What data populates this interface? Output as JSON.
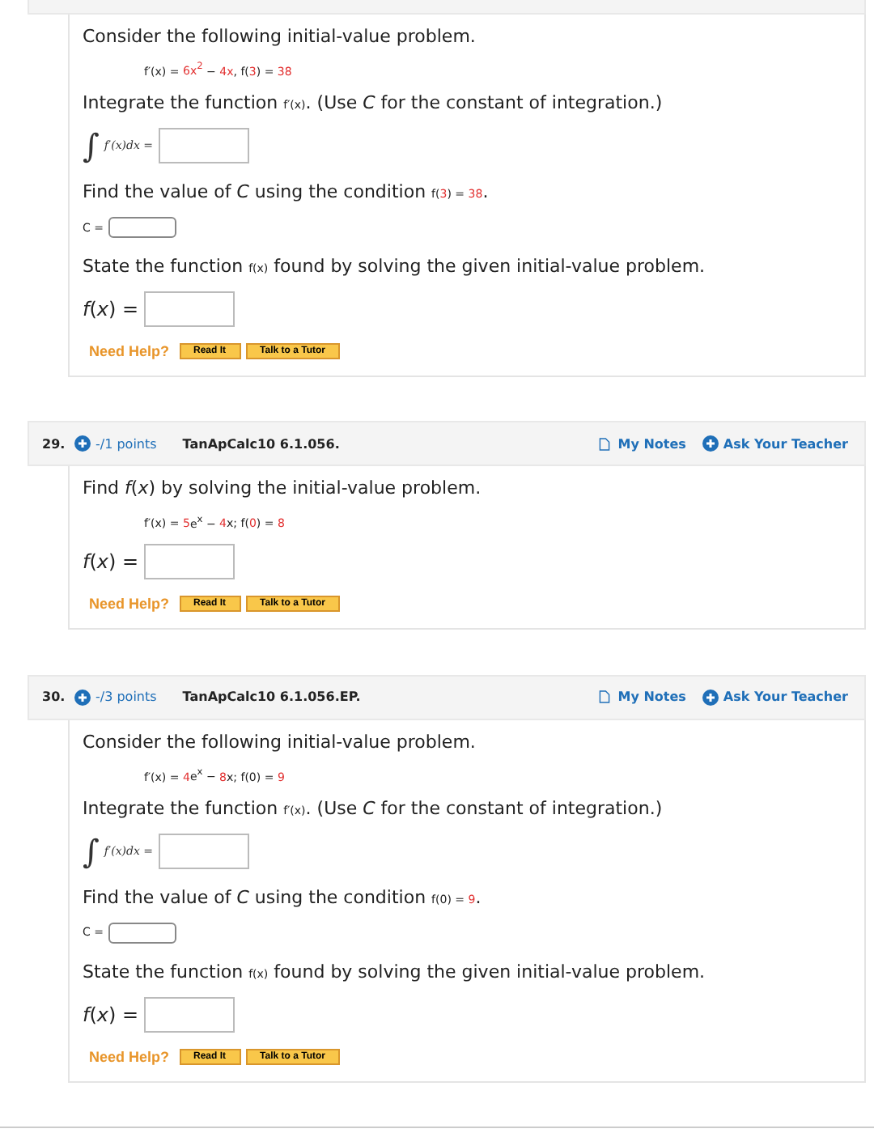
{
  "questions": [
    {
      "parts": [
        {
          "kind": "prose",
          "segments": [
            {
              "kind": "text",
              "text": "Consider the following initial-value problem."
            }
          ]
        },
        {
          "kind": "equation",
          "segments": [
            {
              "kind": "math",
              "text": "f′(x) = "
            },
            {
              "kind": "value",
              "text": "6x$^{2}$"
            },
            {
              "kind": "math",
              "text": " − "
            },
            {
              "kind": "value",
              "text": "4x"
            },
            {
              "kind": "math",
              "text": ", f("
            },
            {
              "kind": "value",
              "text": "3"
            },
            {
              "kind": "math",
              "text": ") = "
            },
            {
              "kind": "value",
              "text": "38"
            }
          ]
        },
        {
          "kind": "prose",
          "segments": [
            {
              "kind": "text",
              "text": "Integrate the function "
            },
            {
              "kind": "math",
              "text": "f′(x)"
            },
            {
              "kind": "text",
              "text": ". (Use *C* for the constant of integration.)"
            }
          ]
        },
        {
          "kind": "integral",
          "sign": "∫",
          "label": "f′(x)dx ="
        },
        {
          "kind": "prose",
          "segments": [
            {
              "kind": "text",
              "text": "Find the value of *C* using the condition "
            },
            {
              "kind": "math",
              "text": "f("
            },
            {
              "kind": "value",
              "text": "3"
            },
            {
              "kind": "math",
              "text": ") = "
            },
            {
              "kind": "value",
              "text": "38"
            },
            {
              "kind": "text",
              "text": "."
            }
          ]
        },
        {
          "kind": "constant",
          "label": "C ="
        },
        {
          "kind": "prose",
          "segments": [
            {
              "kind": "text",
              "text": "State the function "
            },
            {
              "kind": "math",
              "text": "f(x)"
            },
            {
              "kind": "text",
              "text": " found by solving the given initial-value problem."
            }
          ]
        },
        {
          "kind": "function",
          "label": "*f*(*x*) ="
        },
        {
          "kind": "help",
          "label": "Need Help?",
          "buttons": [
            "Read It",
            "Talk to a Tutor"
          ]
        }
      ]
    },
    {
      "header": {
        "number": "29.",
        "points": "-/1 points",
        "code": "TanApCalc10 6.1.056.",
        "notes": "My Notes",
        "ask": "Ask Your Teacher"
      },
      "parts": [
        {
          "kind": "prose",
          "segments": [
            {
              "kind": "text",
              "text": "Find *f*(*x*) by solving the initial-value problem."
            }
          ]
        },
        {
          "kind": "equation",
          "segments": [
            {
              "kind": "math",
              "text": "f′(x) = "
            },
            {
              "kind": "value",
              "text": "5"
            },
            {
              "kind": "math",
              "text": "e$^{x}$ − "
            },
            {
              "kind": "value",
              "text": "4"
            },
            {
              "kind": "math",
              "text": "x; f("
            },
            {
              "kind": "value",
              "text": "0"
            },
            {
              "kind": "math",
              "text": ") = "
            },
            {
              "kind": "value",
              "text": "8"
            }
          ]
        },
        {
          "kind": "function",
          "label": "*f*(*x*) ="
        },
        {
          "kind": "help",
          "label": "Need Help?",
          "buttons": [
            "Read It",
            "Talk to a Tutor"
          ]
        }
      ]
    },
    {
      "header": {
        "number": "30.",
        "points": "-/3 points",
        "code": "TanApCalc10 6.1.056.EP.",
        "notes": "My Notes",
        "ask": "Ask Your Teacher"
      },
      "parts": [
        {
          "kind": "prose",
          "segments": [
            {
              "kind": "text",
              "text": "Consider the following initial-value problem."
            }
          ]
        },
        {
          "kind": "equation",
          "segments": [
            {
              "kind": "math",
              "text": "f′(x) = "
            },
            {
              "kind": "value",
              "text": "4"
            },
            {
              "kind": "math",
              "text": "e$^{x}$ − "
            },
            {
              "kind": "value",
              "text": "8"
            },
            {
              "kind": "math",
              "text": "x; f(0) = "
            },
            {
              "kind": "value",
              "text": "9"
            }
          ]
        },
        {
          "kind": "prose",
          "segments": [
            {
              "kind": "text",
              "text": "Integrate the function "
            },
            {
              "kind": "math",
              "text": "f′(x)"
            },
            {
              "kind": "text",
              "text": ". (Use *C* for the constant of integration.)"
            }
          ]
        },
        {
          "kind": "integral",
          "sign": "∫",
          "label": "f′(x)dx ="
        },
        {
          "kind": "prose",
          "segments": [
            {
              "kind": "text",
              "text": "Find the value of *C* using the condition "
            },
            {
              "kind": "math",
              "text": "f(0) = "
            },
            {
              "kind": "value",
              "text": "9"
            },
            {
              "kind": "text",
              "text": "."
            }
          ]
        },
        {
          "kind": "constant",
          "label": "C ="
        },
        {
          "kind": "prose",
          "segments": [
            {
              "kind": "text",
              "text": "State the function "
            },
            {
              "kind": "math",
              "text": "f(x)"
            },
            {
              "kind": "text",
              "text": " found by solving the given initial-value problem."
            }
          ]
        },
        {
          "kind": "function",
          "label": "*f*(*x*) ="
        },
        {
          "kind": "help",
          "label": "Need Help?",
          "buttons": [
            "Read It",
            "Talk to a Tutor"
          ]
        }
      ]
    }
  ]
}
